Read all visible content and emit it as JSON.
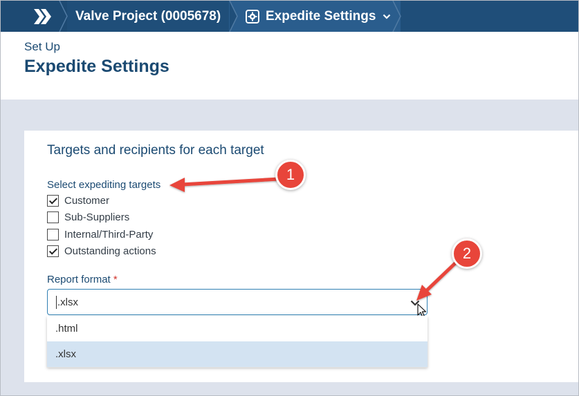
{
  "nav": {
    "project_crumb": "Valve Project (0005678)",
    "settings_crumb": "Expedite Settings",
    "colors": {
      "bar": "#1f4e79",
      "active": "#2a5d8d"
    }
  },
  "header": {
    "section": "Set Up",
    "title": "Expedite Settings"
  },
  "card": {
    "title": "Targets and recipients for each target",
    "targets_label": "Select expediting targets",
    "targets": [
      {
        "label": "Customer",
        "checked": true
      },
      {
        "label": "Sub-Suppliers",
        "checked": false
      },
      {
        "label": "Internal/Third-Party",
        "checked": false
      },
      {
        "label": "Outstanding actions",
        "checked": true
      }
    ],
    "format_label": "Report format",
    "format_required_mark": "*",
    "format_value": ".xlsx",
    "format_options": [
      {
        "label": ".html",
        "selected": false
      },
      {
        "label": ".xlsx",
        "selected": true
      }
    ]
  },
  "annotations": {
    "badge_1": "1",
    "badge_2": "2",
    "color": "#e8453a"
  }
}
